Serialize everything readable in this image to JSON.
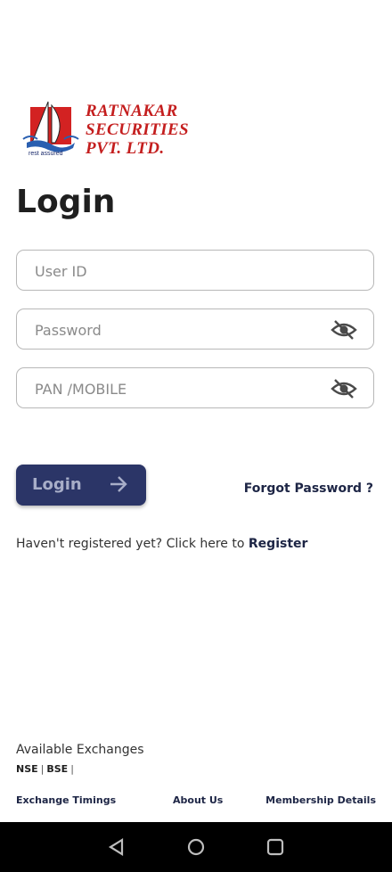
{
  "logo": {
    "company_line1": "RATNAKAR",
    "company_line2": "SECURITIES",
    "company_line3": "PVT. LTD.",
    "tagline": "rest assured",
    "icon": "sailboat-logo-icon"
  },
  "page_title": "Login",
  "form": {
    "user_id_placeholder": "User ID",
    "password_placeholder": "Password",
    "pan_placeholder": "PAN /MOBILE",
    "visibility_icon": "eye-off-icon"
  },
  "login_button": {
    "label": "Login",
    "icon": "arrow-right-icon"
  },
  "forgot_password": "Forgot Password ?",
  "register": {
    "prompt": "Haven't registered yet? Click here to",
    "link": "Register"
  },
  "exchanges": {
    "heading": "Available Exchanges",
    "items": [
      "NSE",
      "BSE"
    ],
    "separator": "|"
  },
  "footer": {
    "timings": "Exchange Timings",
    "about": "About Us",
    "membership": "Membership Details"
  },
  "colors": {
    "primary": "#2b3567",
    "brand_red": "#c41e1e",
    "text_dark": "#1d2545"
  }
}
